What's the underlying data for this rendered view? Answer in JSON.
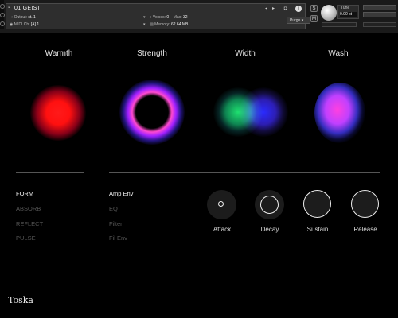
{
  "header": {
    "instrument_name": "01 GEIST",
    "output_label": "Output:",
    "output_value": "st. 1",
    "midi_label": "MIDI Ch:",
    "midi_value": "[A] 1",
    "voices_label": "Voices:",
    "voices_value": "0",
    "max_label": "Max:",
    "max_value": "32",
    "memory_label": "Memory:",
    "memory_value": "62.64 MB",
    "purge_label": "Purge",
    "solo_label": "S",
    "mute_label": "M",
    "tune_label": "Tune",
    "tune_value": "0.00",
    "tune_unit": "st",
    "aux_label": "AUX",
    "pv_label": "PV"
  },
  "params": [
    {
      "label": "Warmth"
    },
    {
      "label": "Strength"
    },
    {
      "label": "Width"
    },
    {
      "label": "Wash"
    }
  ],
  "left_menu": [
    "FORM",
    "ABSORB",
    "REFLECT",
    "PULSE"
  ],
  "mid_menu": [
    "Amp Env",
    "EQ",
    "Filter",
    "Fil Env"
  ],
  "envelope": [
    "Attack",
    "Decay",
    "Sustain",
    "Release"
  ],
  "brand": "Toska",
  "colors": {
    "warmth": "#ff1a1a",
    "strength_ring": "#ff3ccc",
    "width_left": "#19d66a",
    "width_right": "#2a2aff",
    "wash_top": "#ff2dd8",
    "wash_bottom": "#3a3aff"
  }
}
